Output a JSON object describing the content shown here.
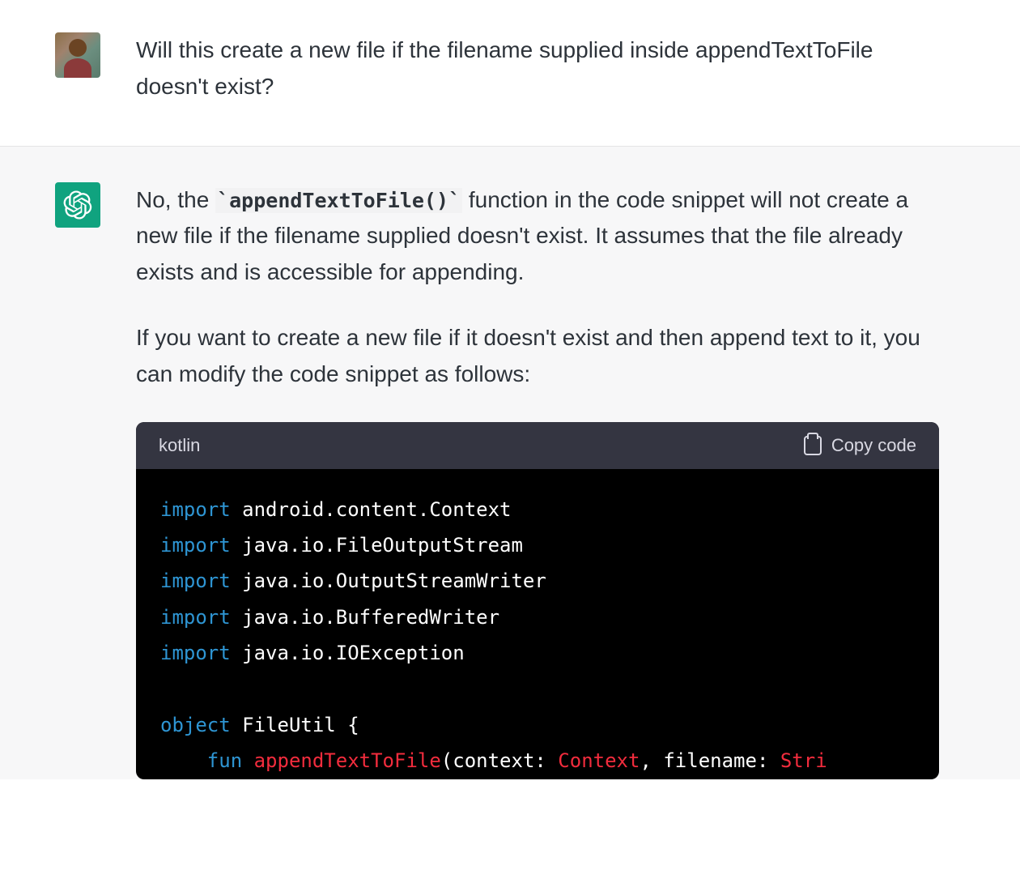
{
  "user_message": {
    "text": "Will this create a new file if the filename supplied inside appendTextToFile doesn't exist?"
  },
  "assistant_message": {
    "paragraph1_pre": "No, the ",
    "inline_code": "`appendTextToFile()`",
    "paragraph1_post": " function in the code snippet will not create a new file if the filename supplied doesn't exist. It assumes that the file already exists and is accessible for appending.",
    "paragraph2": "If you want to create a new file if it doesn't exist and then append text to it, you can modify the code snippet as follows:"
  },
  "code_block": {
    "language": "kotlin",
    "copy_label": "Copy code",
    "tokens": {
      "import_kw": "import",
      "import1": " android.content.Context",
      "import2": " java.io.FileOutputStream",
      "import3": " java.io.OutputStreamWriter",
      "import4": " java.io.BufferedWriter",
      "import5": " java.io.IOException",
      "object_kw": "object",
      "object_name": " FileUtil {",
      "fun_kw": "fun",
      "fun_name": "appendTextToFile",
      "param_open": "(context: ",
      "type_context": "Context",
      "param_sep": ", filename: ",
      "type_string": "Stri"
    }
  }
}
